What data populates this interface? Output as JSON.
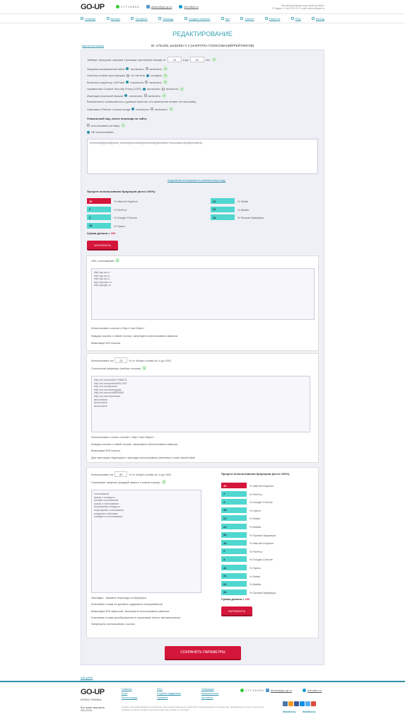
{
  "header": {
    "logo": "GO-UP",
    "phone": "1 7 7 1 5 9 0 0",
    "email": "admin@go-up.ru",
    "skype": "live:allen-ru",
    "info_line1": "Вы авторизованы под логином admin",
    "info_line2": "IP адрес: 5.164.229.76, E-mail: admin@mail.ru"
  },
  "nav": [
    "Главная",
    "Баланс",
    "Профиль",
    "Помощь",
    "Создать шаблон",
    "Кит",
    "Тикеты",
    "Новости",
    "FAQ",
    "Выход"
  ],
  "page": {
    "title": "РЕДАКТИРОВАНИЕ",
    "back": "вернуться назад",
    "template_id": "ID: 4751293, ШАБЛОН # 2 (НАКРУТКА ГОЛОСОВАНИЙ/РЕЙТИНГОВ)"
  },
  "settings": {
    "timeout_label": "Таймаут прогрузки загрузки страницы при первом заходе от",
    "timeout_from": "15",
    "timeout_to_label": "и до",
    "timeout_to": "25",
    "timeout_unit": "сек.",
    "opts": [
      {
        "label": "Загрузка изображений сайта",
        "a": "отключить",
        "b": "включить",
        "sel": "a"
      },
      {
        "label": "Очистка cookies при загрузке",
        "a": "не чистить",
        "b": "очищать",
        "sel": "b"
      },
      {
        "label": "Включить эмулятор JS/Flash",
        "a": "отключить",
        "b": "включить",
        "sel": "a"
      },
      {
        "label": "Управление Content Security Policy (CSP)",
        "a": "отключить",
        "b": "включить",
        "sel": "a"
      },
      {
        "label": "Имитация реальной мышки",
        "a": "отключить",
        "b": "включить",
        "sel": "a"
      }
    ],
    "warning": "Внимательно ознакомьтесь с данным пунктом, его включение влияет на настройку",
    "referer_label": "Связывать Referer и поиск входа",
    "referer_a": "отключить",
    "referer_b": "включить",
    "unique_title": "Уникальный код, после перехода по сайту",
    "unique_a": "использовать вставку",
    "unique_b": "НЕ использовать",
    "code": "{eventclick}{inputid}{some_textclick}{eventclick}{eventclick}{inputvalue?голосовать,click}{eventclick}",
    "instr_link": "подробная инструкция по уникальному коду"
  },
  "browsers": {
    "title": "Процент использования браузеров (всего 100%)",
    "left": [
      {
        "v": "10",
        "l": "% Internet Explorer",
        "red": true
      },
      {
        "v": "2",
        "l": "% FireFox"
      },
      {
        "v": "3",
        "l": "% Google Chrome"
      },
      {
        "v": "44",
        "l": "% Opera"
      }
    ],
    "right": [
      {
        "v": "21",
        "l": "% Safari"
      },
      {
        "v": "22",
        "l": "% Mobile"
      },
      {
        "v": "34",
        "l": "% Прочие браузеры"
      }
    ],
    "sum_label": "Сумма должна = ",
    "sum": "100",
    "fill": "ЗАПОЛНИТЬ"
  },
  "url_block": {
    "label": "URL голосований",
    "urls": "http://go-up.ru\nhttp://go-up.ru\nhttp://go-up.ru\nhttp://yandex.ru\nhttp://google.ru",
    "notes": [
      "Использовать ссылки с http:// или https://",
      "Каждая ссылка с новой строки, запрещено использовать кавычки",
      "Максимум 500 ссылок"
    ]
  },
  "ref_block": {
    "use_label": "Использовать на",
    "percent": "20",
    "pct_suffix": "% от общего колва (от 0 до 100)",
    "label": "Ссылочный реферер (любые ссылки)",
    "refs": "http://vk.com/public77088121\nhttp://vk.com/public60512447\nhttp://vk.com/jbzavai\nhttp://vk.com/zabeignjdz\nhttp://vk.com/club8830806\nhttp://vk.com/xoteeskal\nabout:blank\nabout:blank\nabout:blank",
    "notes": [
      "Использовать только ссылки с http:// или https://",
      "Каждая ссылка с новой строки, запрещено использовать кавычки",
      "Максимум 500 ссылок",
      "Для имитации переходов с закладок использовать ключевое слово about:blank"
    ]
  },
  "search_block": {
    "use_label": "Использовать на",
    "percent": "80",
    "pct_suffix": "% от общего колва (от 0 до 100)",
    "label": "Поисковые запросы (каждый запрос с новой строки)",
    "queries": "голосования\nпризы и конкурсы\nонлайн голосований\nпризы в голосовании\nпопулярные конкурсы\nпопулярные голосования\nконкурсы и призами\nпобедить в голосовании",
    "notes": [
      "Закладки - прямые переходы из браузера",
      "Ключевые слова не должны содержать спецсимволов",
      "Максимум 500 запросов, запрещено использовать кавычки",
      "Ключевые слова преобразуются в поисковый referer автоматически",
      "Запрещено использовать ссылки"
    ],
    "browsers_title": "Процент использования браузеров (всего 100%)",
    "browsers": [
      {
        "v": "10",
        "l": "% Internet Explorer",
        "red": true
      },
      {
        "v": "2",
        "l": "% FireFox"
      },
      {
        "v": "3",
        "l": "% Google Chrome"
      },
      {
        "v": "44",
        "l": "% Opera"
      },
      {
        "v": "21",
        "l": "% Safari"
      },
      {
        "v": "22",
        "l": "% Mobile"
      },
      {
        "v": "34",
        "l": "% Прочие браузеры"
      },
      {
        "v": "10",
        "l": "% Internet Explorer"
      },
      {
        "v": "2",
        "l": "% FireFox"
      },
      {
        "v": "3",
        "l": "% Google Chrome"
      },
      {
        "v": "44",
        "l": "% Opera"
      },
      {
        "v": "21",
        "l": "% Safari"
      },
      {
        "v": "22",
        "l": "% Mobile"
      },
      {
        "v": "34",
        "l": "% Прочие браузеры"
      }
    ],
    "sum_label": "Сумма должна = ",
    "sum": "100",
    "fill": "ЗАПОЛНИТЬ"
  },
  "save": "СОХРАНИТЬ ПАРАМЕТРЫ",
  "small_link": "s26-pelit0",
  "footer": {
    "logo": "GO-UP",
    "tagline": "БИРЖА ТРАФИКА",
    "col1": [
      "Главная",
      "Блог",
      "Регистрация"
    ],
    "col2": [
      "FAQ",
      "Служба поддержки",
      "Правила"
    ],
    "col3": [
      "Операции",
      "Безопасность",
      "Контакты"
    ],
    "copyright": "Все права защищены 2011-2016",
    "disclaimer": "Сервис голосования/накрутки рейтингов, регистраций шаблонов и действий с визуализацией пользователей, продвижение и клики, количество трафика, которым трафик и качество ведёт веб-трафик по ссылкам.",
    "phone": "1 7 7 1 5 9 0 0",
    "email": "admin@go-up.ru",
    "skype": "live:allen-ru",
    "pay1": "WebMoney",
    "pay2": "WebMoney"
  }
}
